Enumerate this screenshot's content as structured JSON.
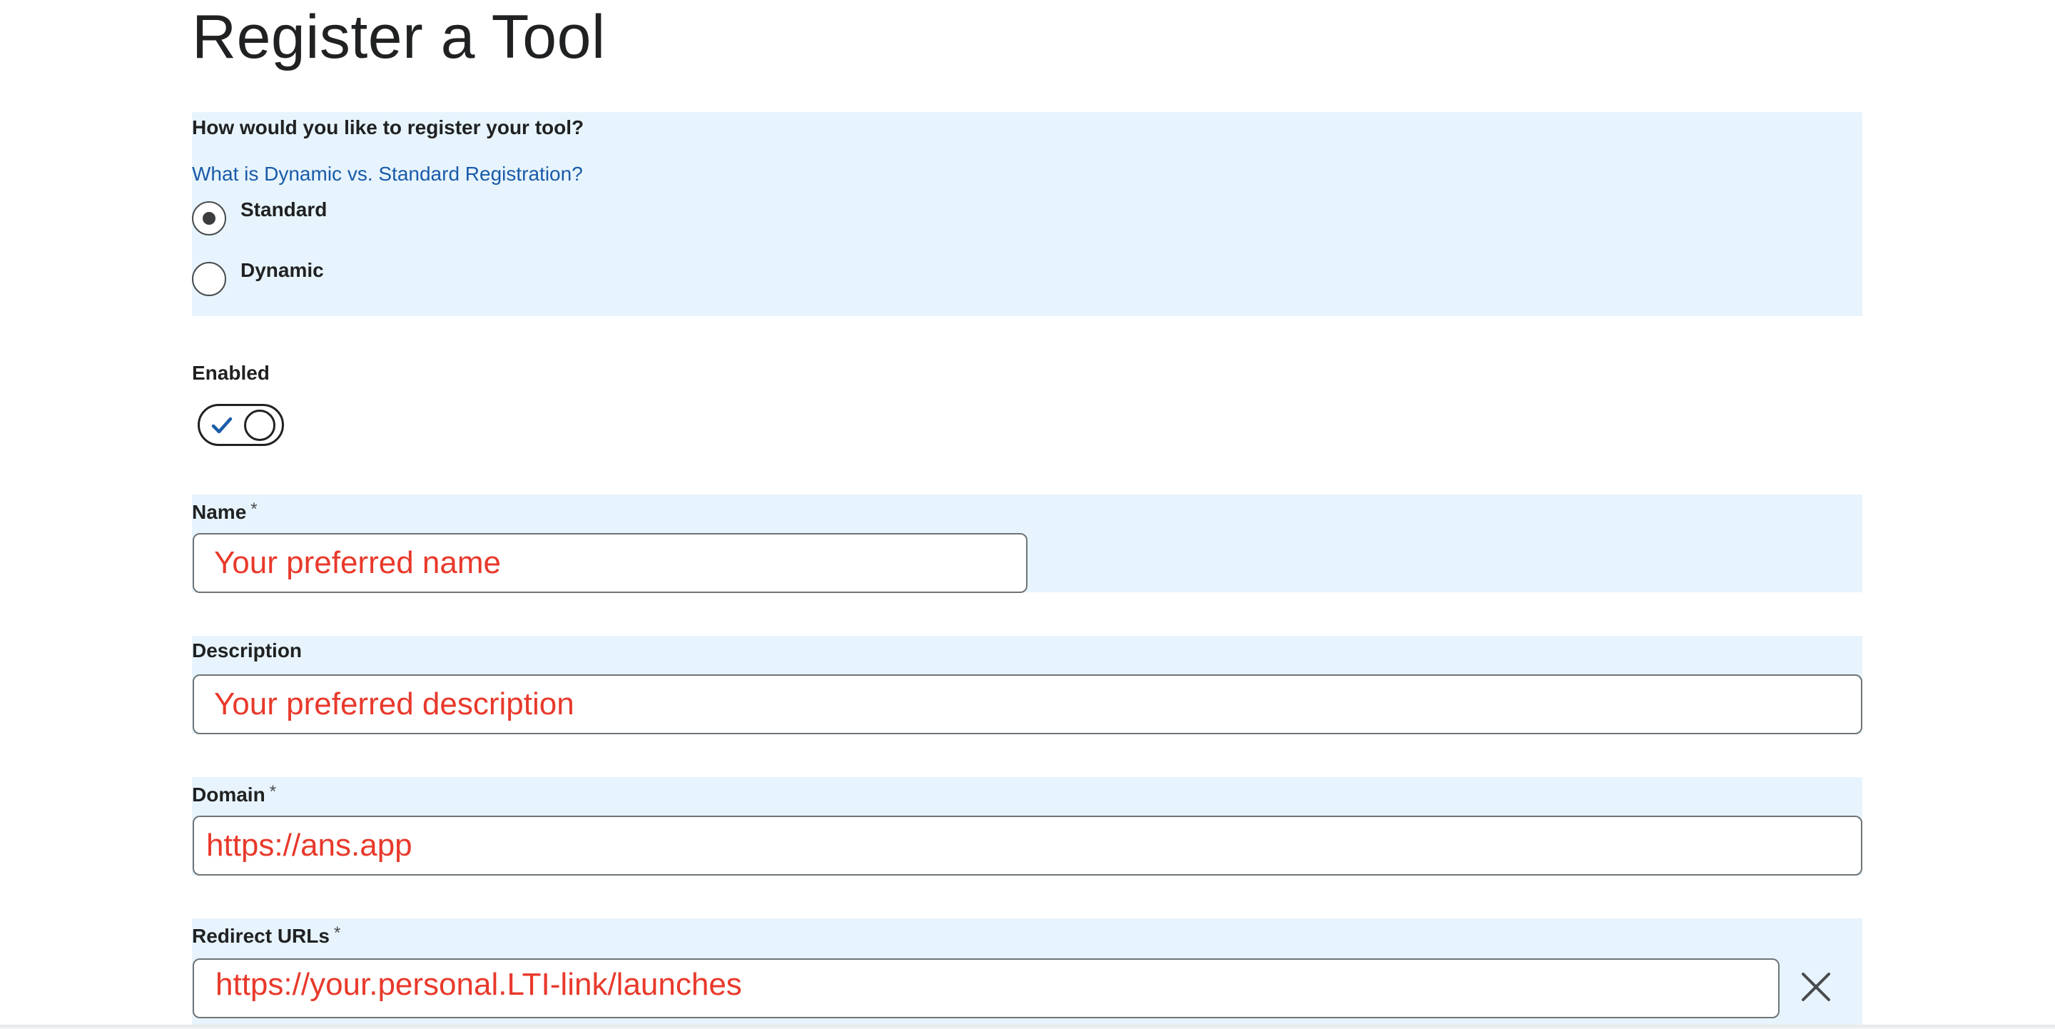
{
  "page": {
    "title": "Register a Tool"
  },
  "registration": {
    "question": "How would you like to register your tool?",
    "help_link": "What is Dynamic vs. Standard Registration?",
    "options": [
      {
        "label": "Standard",
        "selected": true
      },
      {
        "label": "Dynamic",
        "selected": false
      }
    ]
  },
  "enabled": {
    "label": "Enabled",
    "value": true,
    "icon": "checkmark-icon"
  },
  "fields": {
    "name": {
      "label": "Name",
      "required_mark": "*",
      "value": "Your preferred name"
    },
    "description": {
      "label": "Description",
      "value": "Your preferred description"
    },
    "domain": {
      "label": "Domain",
      "required_mark": "*",
      "value": "https://ans.app"
    },
    "redirect_urls": {
      "label": "Redirect URLs",
      "required_mark": "*",
      "value": "https://your.personal.LTI-link/launches",
      "remove_icon": "close-icon"
    }
  },
  "colors": {
    "band_background": "#e7f4fd",
    "link": "#1a5ba8",
    "field_text": "#e8392b",
    "toggle_check": "#1a5ba8"
  }
}
